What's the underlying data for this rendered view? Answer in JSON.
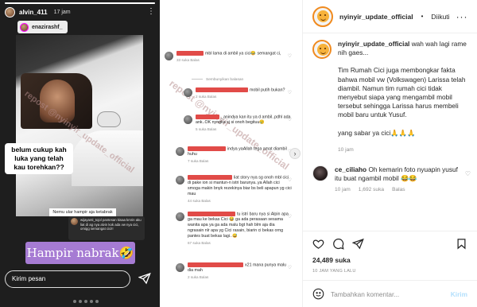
{
  "story": {
    "username": "alvin_411",
    "time": "17 jam",
    "repost_user": "enazirashf_",
    "caption": "belum cukup kah luka yang telah kau torehkan??",
    "sub_caption": "Nemu ular hampir aja ketabrak",
    "mini_comment": "wijayanti_tojol pantesan kisaa kmrin aku liat di ag nya alvin kok ada vw nya cici, omigg semangat cici!!",
    "sticker": "Hampir nabrak🤣",
    "input_placeholder": "Kirim pesan",
    "watermark": "repost @nyinyir_update_official"
  },
  "comments_shot": {
    "reply_divider": "Sembunyikan balasan",
    "items": [
      {
        "text": "mbl lama di ambil ya cici😂 semangat ci,",
        "meta": "33 suka   Balas"
      },
      {
        "text": "mobil putih bukan?",
        "meta": "2 suka   Balas"
      },
      {
        "text": "_anindya kan itu ya d ambil..pdhl ada ank..OK nyngka sj si onoh begituu😢",
        "meta": "5 suka   Balas"
      },
      {
        "text": "indya yaAllah tega amat diambil huhu",
        "meta": "7 suka   Balas"
      },
      {
        "text": "liat story nya sg onoh mbl cici di pake ion si mantun-n istri barunya..ya Allah cici smoga makin bnyk rezekinya biar bs beli apapun yg cici mau",
        "meta": "44 suka   Balas"
      },
      {
        "text": "tu istri baru nya si Alpin apa ga mau ke bekas Cici 😂 ga ada perasaan sesama wanita apa ya ga ada malu bgt hah blm aja dia ngrasain nlr apa yg Cici rasain, biarin ci bekas orng pantes buat bekas lagi..😅",
        "meta": "67 suka   Balas"
      },
      {
        "text": "x21 mana punya malu dia mah",
        "meta": "2 suka   Balas"
      }
    ]
  },
  "post": {
    "username": "nyinyir_update_official",
    "follow_label": "Diikuti",
    "caption_user": "nyinyir_update_official",
    "caption_lead": "wah wah lagi rame nih gaes...",
    "caption_body": "Tim Rumah Cici juga membongkar fakta bahwa mobil vw (Volkswagen) Larissa telah diambil. Namun tim rumah cici tidak menyebut siapa yang mengambil mobil tersebut sehingga Larissa harus membeli mobil baru untuk Yusuf.",
    "caption_end": "yang sabar ya cici🙏🙏🙏",
    "caption_time": "10 jam",
    "comment": {
      "user": "ce_ciliaho",
      "text": "Oh kemarin foto nyuapin yusuf itu buat ngambil mobil 😂😂",
      "time": "10 jam",
      "likes": "1,692 suka",
      "reply": "Balas"
    },
    "likes": "24,489 suka",
    "date": "10 JAM YANG LALU",
    "add_comment_placeholder": "Tambahkan komentar...",
    "post_button": "Kirim"
  },
  "colors": {
    "redaction": "#e14b48",
    "sticker_bg": "#a67bd3",
    "post_button": "#b2dffc"
  }
}
